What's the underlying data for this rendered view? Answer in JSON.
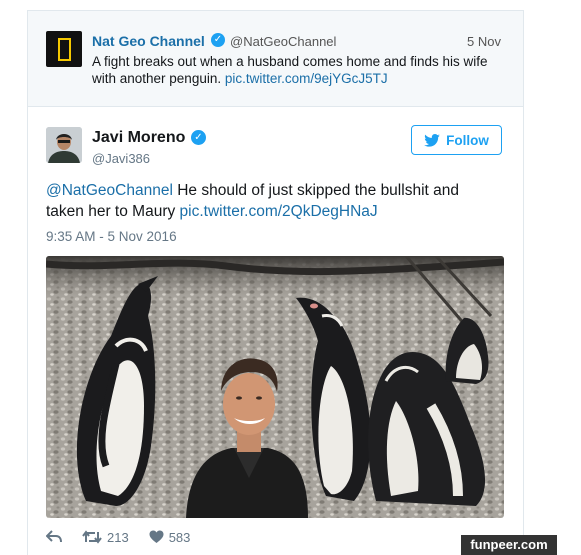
{
  "quoted_tweet": {
    "name": "Nat Geo Channel",
    "handle": "@NatGeoChannel",
    "date": "5 Nov",
    "text": "A fight breaks out when a husband comes home and finds his wife with another penguin.",
    "link": "pic.twitter.com/9ejYGcJ5TJ"
  },
  "tweet": {
    "name": "Javi Moreno",
    "handle": "@Javi386",
    "follow_label": "Follow",
    "mention": "@NatGeoChannel",
    "text": "He should of just skipped the bullshit and taken her to Maury",
    "link": "pic.twitter.com/2QkDegHNaJ",
    "timestamp": "9:35 AM - 5 Nov 2016",
    "retweets": "213",
    "likes": "583"
  },
  "icons": {
    "reply": "reply-icon",
    "retweet": "retweet-icon",
    "like": "heart-icon",
    "verified": "verified-badge-icon",
    "bird": "twitter-bird-icon"
  },
  "colors": {
    "link": "#1b6fa8",
    "twitter_blue": "#1da1f2",
    "muted": "#657786",
    "natgeo_yellow": "#f6c900"
  },
  "watermark": "funpeer.com"
}
